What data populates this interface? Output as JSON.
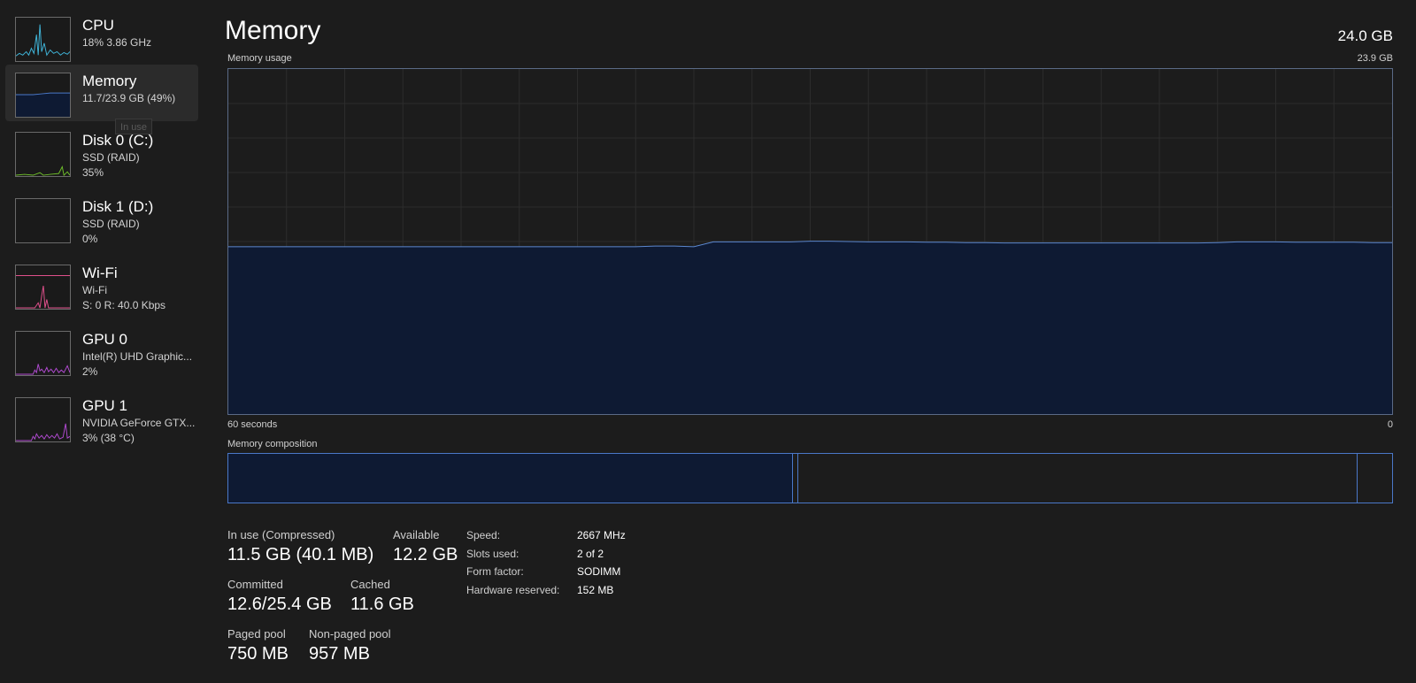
{
  "sidebar": {
    "items": [
      {
        "title": "CPU",
        "sub1": "18%  3.86 GHz",
        "sub2": "",
        "icon": "cpu-graph-icon",
        "color": "#3fb4d8"
      },
      {
        "title": "Memory",
        "sub1": "11.7/23.9 GB (49%)",
        "sub2": "",
        "icon": "memory-graph-icon",
        "color": "#4a78c8"
      },
      {
        "title": "Disk 0 (C:)",
        "sub1": "SSD (RAID)",
        "sub2": "35%",
        "icon": "disk-graph-icon",
        "color": "#6fbf2a"
      },
      {
        "title": "Disk 1 (D:)",
        "sub1": "SSD (RAID)",
        "sub2": "0%",
        "icon": "disk-graph-icon",
        "color": "#6fbf2a"
      },
      {
        "title": "Wi-Fi",
        "sub1": "Wi-Fi",
        "sub2": "S: 0  R: 40.0 Kbps",
        "icon": "network-graph-icon",
        "color": "#e0508c"
      },
      {
        "title": "GPU 0",
        "sub1": "Intel(R) UHD Graphic...",
        "sub2": "2%",
        "icon": "gpu-graph-icon",
        "color": "#b04ad0"
      },
      {
        "title": "GPU 1",
        "sub1": "NVIDIA GeForce GTX...",
        "sub2": "3%  (38 °C)",
        "icon": "gpu-graph-icon",
        "color": "#b04ad0"
      }
    ],
    "tooltip": "In use"
  },
  "main": {
    "title": "Memory",
    "total": "24.0 GB",
    "usage_label": "Memory usage",
    "usage_max": "23.9 GB",
    "time_left": "60 seconds",
    "time_right": "0",
    "composition_label": "Memory composition",
    "composition": {
      "in_use": 0.485,
      "modified": 0.005,
      "standby": 0.48,
      "free": 0.03
    }
  },
  "usage_series": [
    0.485,
    0.485,
    0.485,
    0.485,
    0.485,
    0.485,
    0.485,
    0.485,
    0.485,
    0.485,
    0.485,
    0.485,
    0.485,
    0.485,
    0.485,
    0.485,
    0.485,
    0.485,
    0.485,
    0.485,
    0.485,
    0.485,
    0.487,
    0.487,
    0.485,
    0.499,
    0.499,
    0.499,
    0.499,
    0.499,
    0.501,
    0.501,
    0.5,
    0.499,
    0.499,
    0.499,
    0.498,
    0.498,
    0.497,
    0.497,
    0.496,
    0.496,
    0.496,
    0.496,
    0.496,
    0.496,
    0.496,
    0.496,
    0.496,
    0.496,
    0.496,
    0.497,
    0.499,
    0.499,
    0.499,
    0.498,
    0.498,
    0.498,
    0.498,
    0.497,
    0.497
  ],
  "stats": {
    "in_use_label": "In use (Compressed)",
    "in_use_value": "11.5 GB (40.1 MB)",
    "available_label": "Available",
    "available_value": "12.2 GB",
    "committed_label": "Committed",
    "committed_value": "12.6/25.4 GB",
    "cached_label": "Cached",
    "cached_value": "11.6 GB",
    "paged_label": "Paged pool",
    "paged_value": "750 MB",
    "nonpaged_label": "Non-paged pool",
    "nonpaged_value": "957 MB"
  },
  "details": {
    "speed_label": "Speed:",
    "speed_value": "2667 MHz",
    "slots_label": "Slots used:",
    "slots_value": "2 of 2",
    "form_label": "Form factor:",
    "form_value": "SODIMM",
    "reserved_label": "Hardware reserved:",
    "reserved_value": "152 MB"
  },
  "colors": {
    "accent": "#4a78c8",
    "fill": "#0e1a33",
    "line": "#5b87cf",
    "grid": "#2c2c2c"
  }
}
